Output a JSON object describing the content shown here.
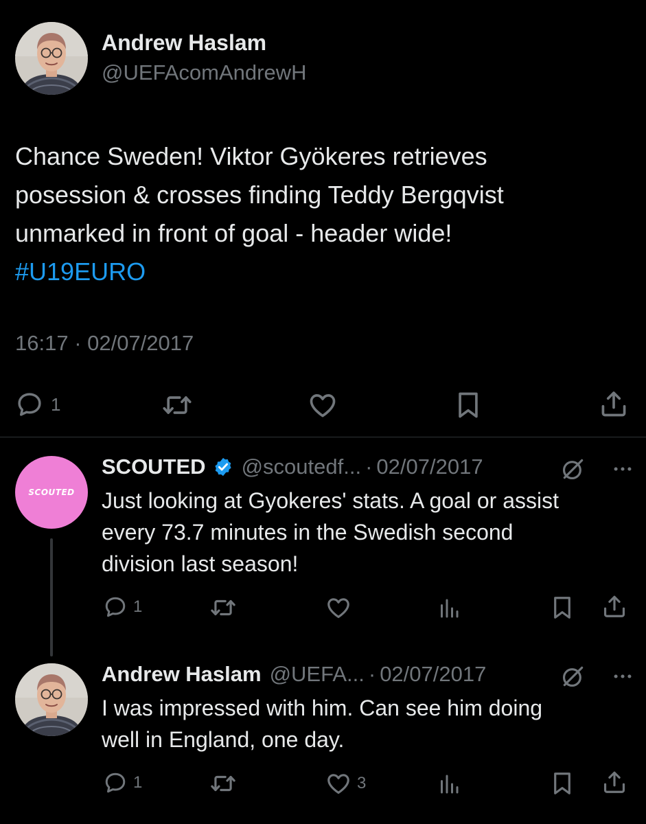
{
  "main_tweet": {
    "author_name": "Andrew Haslam",
    "author_handle": "@UEFAcomAndrewH",
    "text_lines": [
      "Chance Sweden! Viktor Gyökeres retrieves",
      "posession & crosses finding Teddy Bergqvist",
      "unmarked in front of goal - header wide!"
    ],
    "hashtag": "#U19EURO",
    "timestamp": "16:17 · 02/07/2017",
    "reply_count": "1"
  },
  "replies": [
    {
      "author_name": "SCOUTED",
      "verified": true,
      "handle": "@scoutedf...",
      "dot": "·",
      "date": "02/07/2017",
      "avatar_text": "SCOUTED",
      "avatar_color": "#ef7fd6",
      "text_lines": [
        "Just looking at Gyokeres' stats. A goal or assist",
        "every 73.7 minutes in the Swedish second",
        "division last season!"
      ],
      "reply_count": "1",
      "like_count": ""
    },
    {
      "author_name": "Andrew Haslam",
      "verified": false,
      "handle": "@UEFA...",
      "dot": "·",
      "date": "02/07/2017",
      "text_lines": [
        "I was impressed with him. Can see him doing",
        "well in England, one day."
      ],
      "reply_count": "1",
      "like_count": "3"
    }
  ],
  "colors": {
    "background": "#000000",
    "text": "#e7e9ea",
    "muted": "#71767b",
    "link": "#1d9bf0",
    "verified": "#1d9bf0"
  },
  "icons": [
    "reply-icon",
    "retweet-icon",
    "like-icon",
    "bookmark-icon",
    "share-icon",
    "views-icon",
    "grok-icon",
    "more-icon",
    "verified-badge-icon"
  ]
}
